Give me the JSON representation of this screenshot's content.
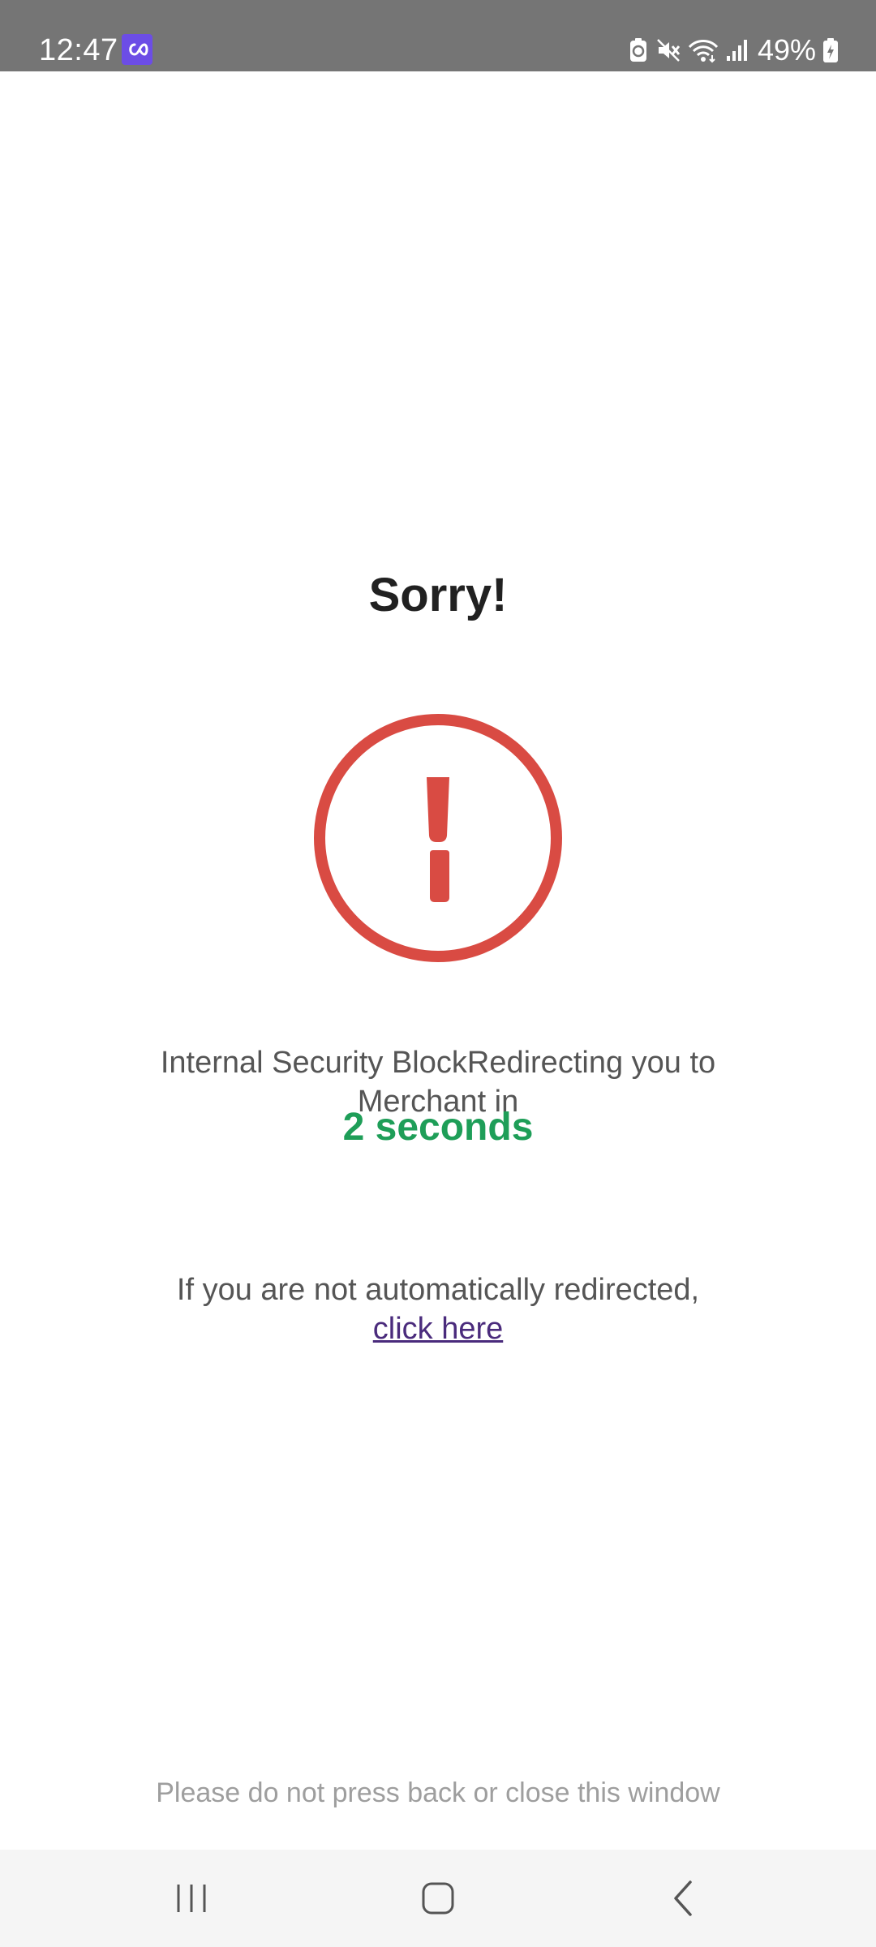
{
  "status_bar": {
    "time": "12:47",
    "battery_percent": "49%",
    "icons": [
      "link-app-icon",
      "battery-saver-icon",
      "mute-icon",
      "wifi-icon",
      "signal-icon",
      "battery-charging-icon"
    ]
  },
  "page": {
    "title": "Sorry!",
    "alert_icon": "exclamation-circle-icon",
    "message": "Internal Security BlockRedirecting you to Merchant in",
    "countdown": "2 seconds",
    "redirect_prefix": "If you are not automatically redirected, ",
    "redirect_link": "click here",
    "footer_note": "Please do not press back or close this window"
  },
  "nav_bar": {
    "buttons": [
      "recents-icon",
      "home-icon",
      "back-icon"
    ]
  },
  "colors": {
    "alert_red": "#d94b43",
    "countdown_green": "#1e9e58",
    "link_purple": "#4a2b7c",
    "status_bar_bg": "#757575",
    "nav_bar_bg": "#f5f5f5"
  }
}
